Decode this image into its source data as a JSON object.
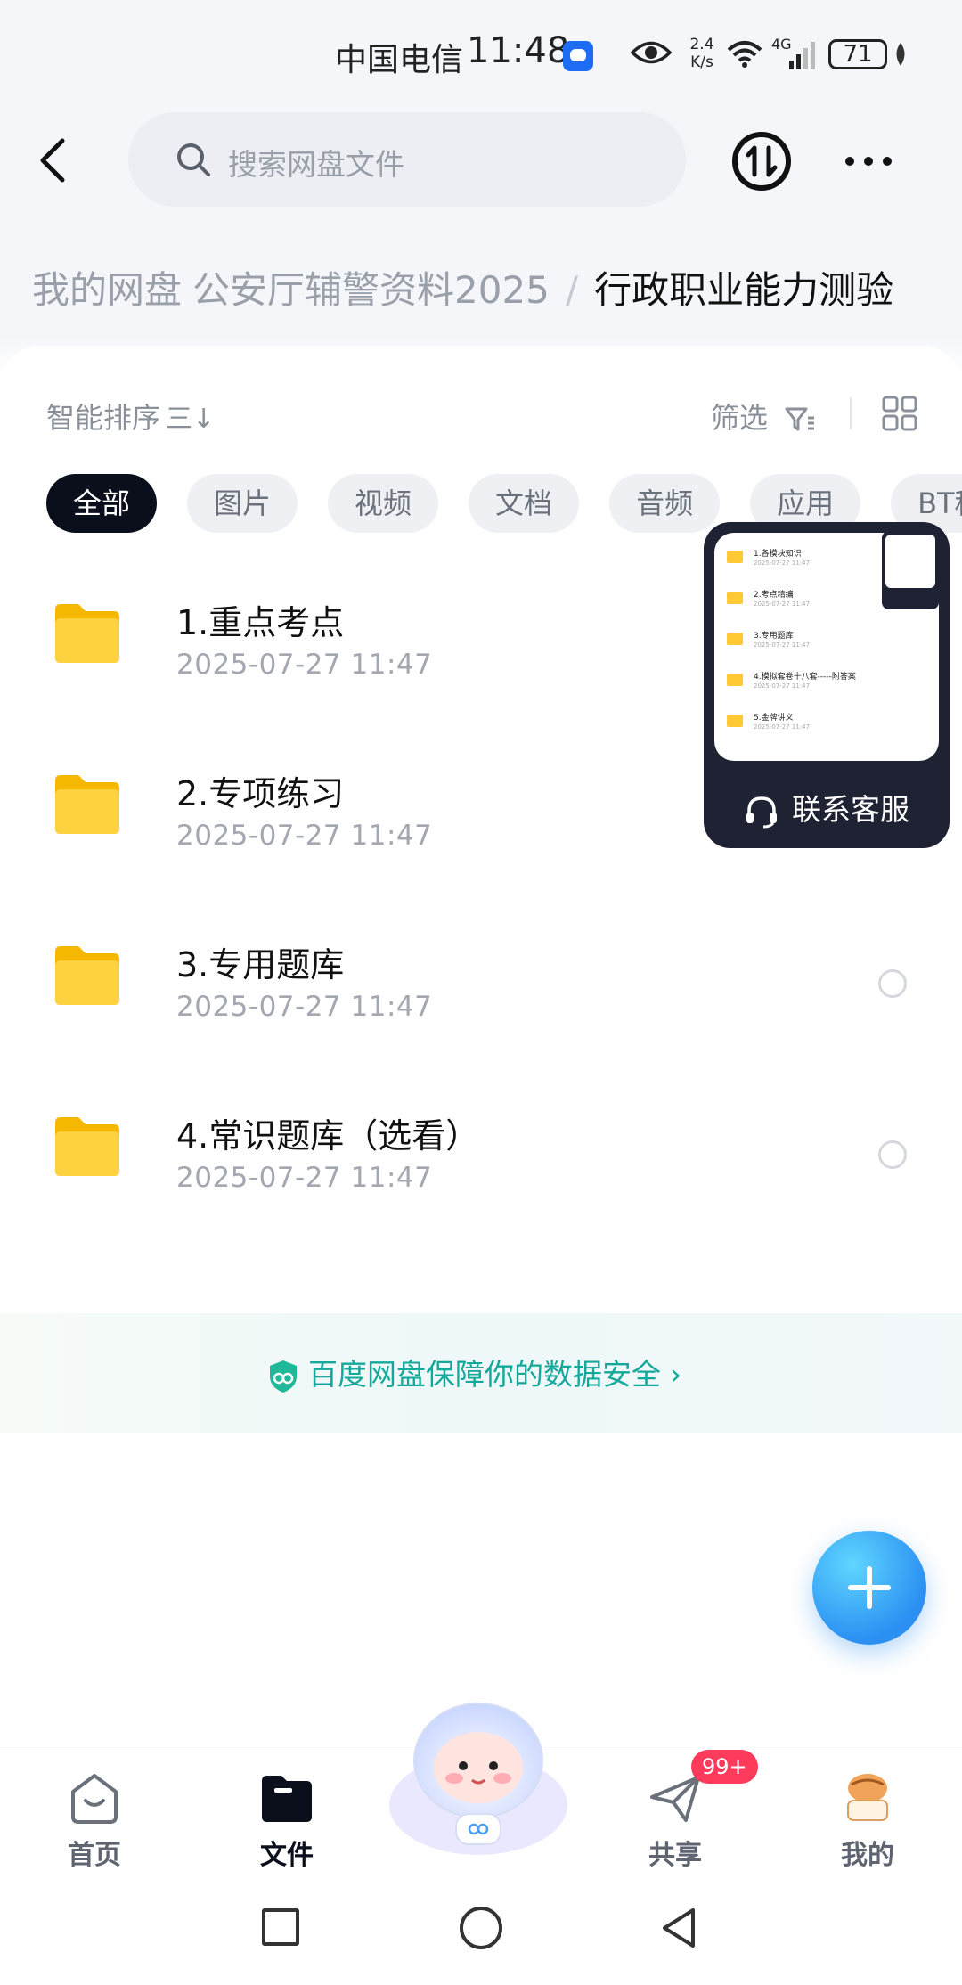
{
  "status_bar": {
    "carrier": "中国电信",
    "time": "11:48",
    "net_speed": "2.4 K/s",
    "net_type": "4G",
    "battery": "71"
  },
  "top_bar": {
    "search_placeholder": "搜索网盘文件"
  },
  "breadcrumb": {
    "root": "我的网盘",
    "middle": "公安厅辅警资料2025",
    "separator": "/",
    "current": "行政职业能力测验"
  },
  "toolbar": {
    "sort_label": "智能排序",
    "sort_icon": "三↓",
    "filter_label": "筛选"
  },
  "chips": [
    "全部",
    "图片",
    "视频",
    "文档",
    "音频",
    "应用",
    "BT种"
  ],
  "files": [
    {
      "name": "1.重点考点",
      "date": "2025-07-27  11:47"
    },
    {
      "name": "2.专项练习",
      "date": "2025-07-27  11:47"
    },
    {
      "name": "3.专用题库",
      "date": "2025-07-27  11:47"
    },
    {
      "name": "4.常识题库（选看）",
      "date": "2025-07-27  11:47"
    }
  ],
  "cs_float": {
    "label": "联系客服",
    "preview_rows": [
      {
        "t": "1.各模块知识",
        "d": "2025-07-27 11:47"
      },
      {
        "t": "2.考点精编",
        "d": "2025-07-27 11:47"
      },
      {
        "t": "3.专用题库",
        "d": "2025-07-27 11:47"
      },
      {
        "t": "4.模拟套卷十八套-----附答案",
        "d": "2025-07-27 11:47"
      },
      {
        "t": "5.金牌讲义",
        "d": "2025-07-27 11:47"
      }
    ]
  },
  "security_banner": {
    "text": "百度网盘保障你的数据安全",
    "chevron": "›"
  },
  "bottom_nav": {
    "items": [
      {
        "label": "首页"
      },
      {
        "label": "文件"
      },
      {
        "label": "共享"
      },
      {
        "label": "我的"
      }
    ],
    "share_badge": "99+",
    "active": "文件"
  },
  "colors": {
    "accent": "#2b90f2",
    "security_text": "#14a89a",
    "folder": "#ffc933",
    "chip_active_bg": "#0b0f1c",
    "badge": "#ff3b5c"
  }
}
